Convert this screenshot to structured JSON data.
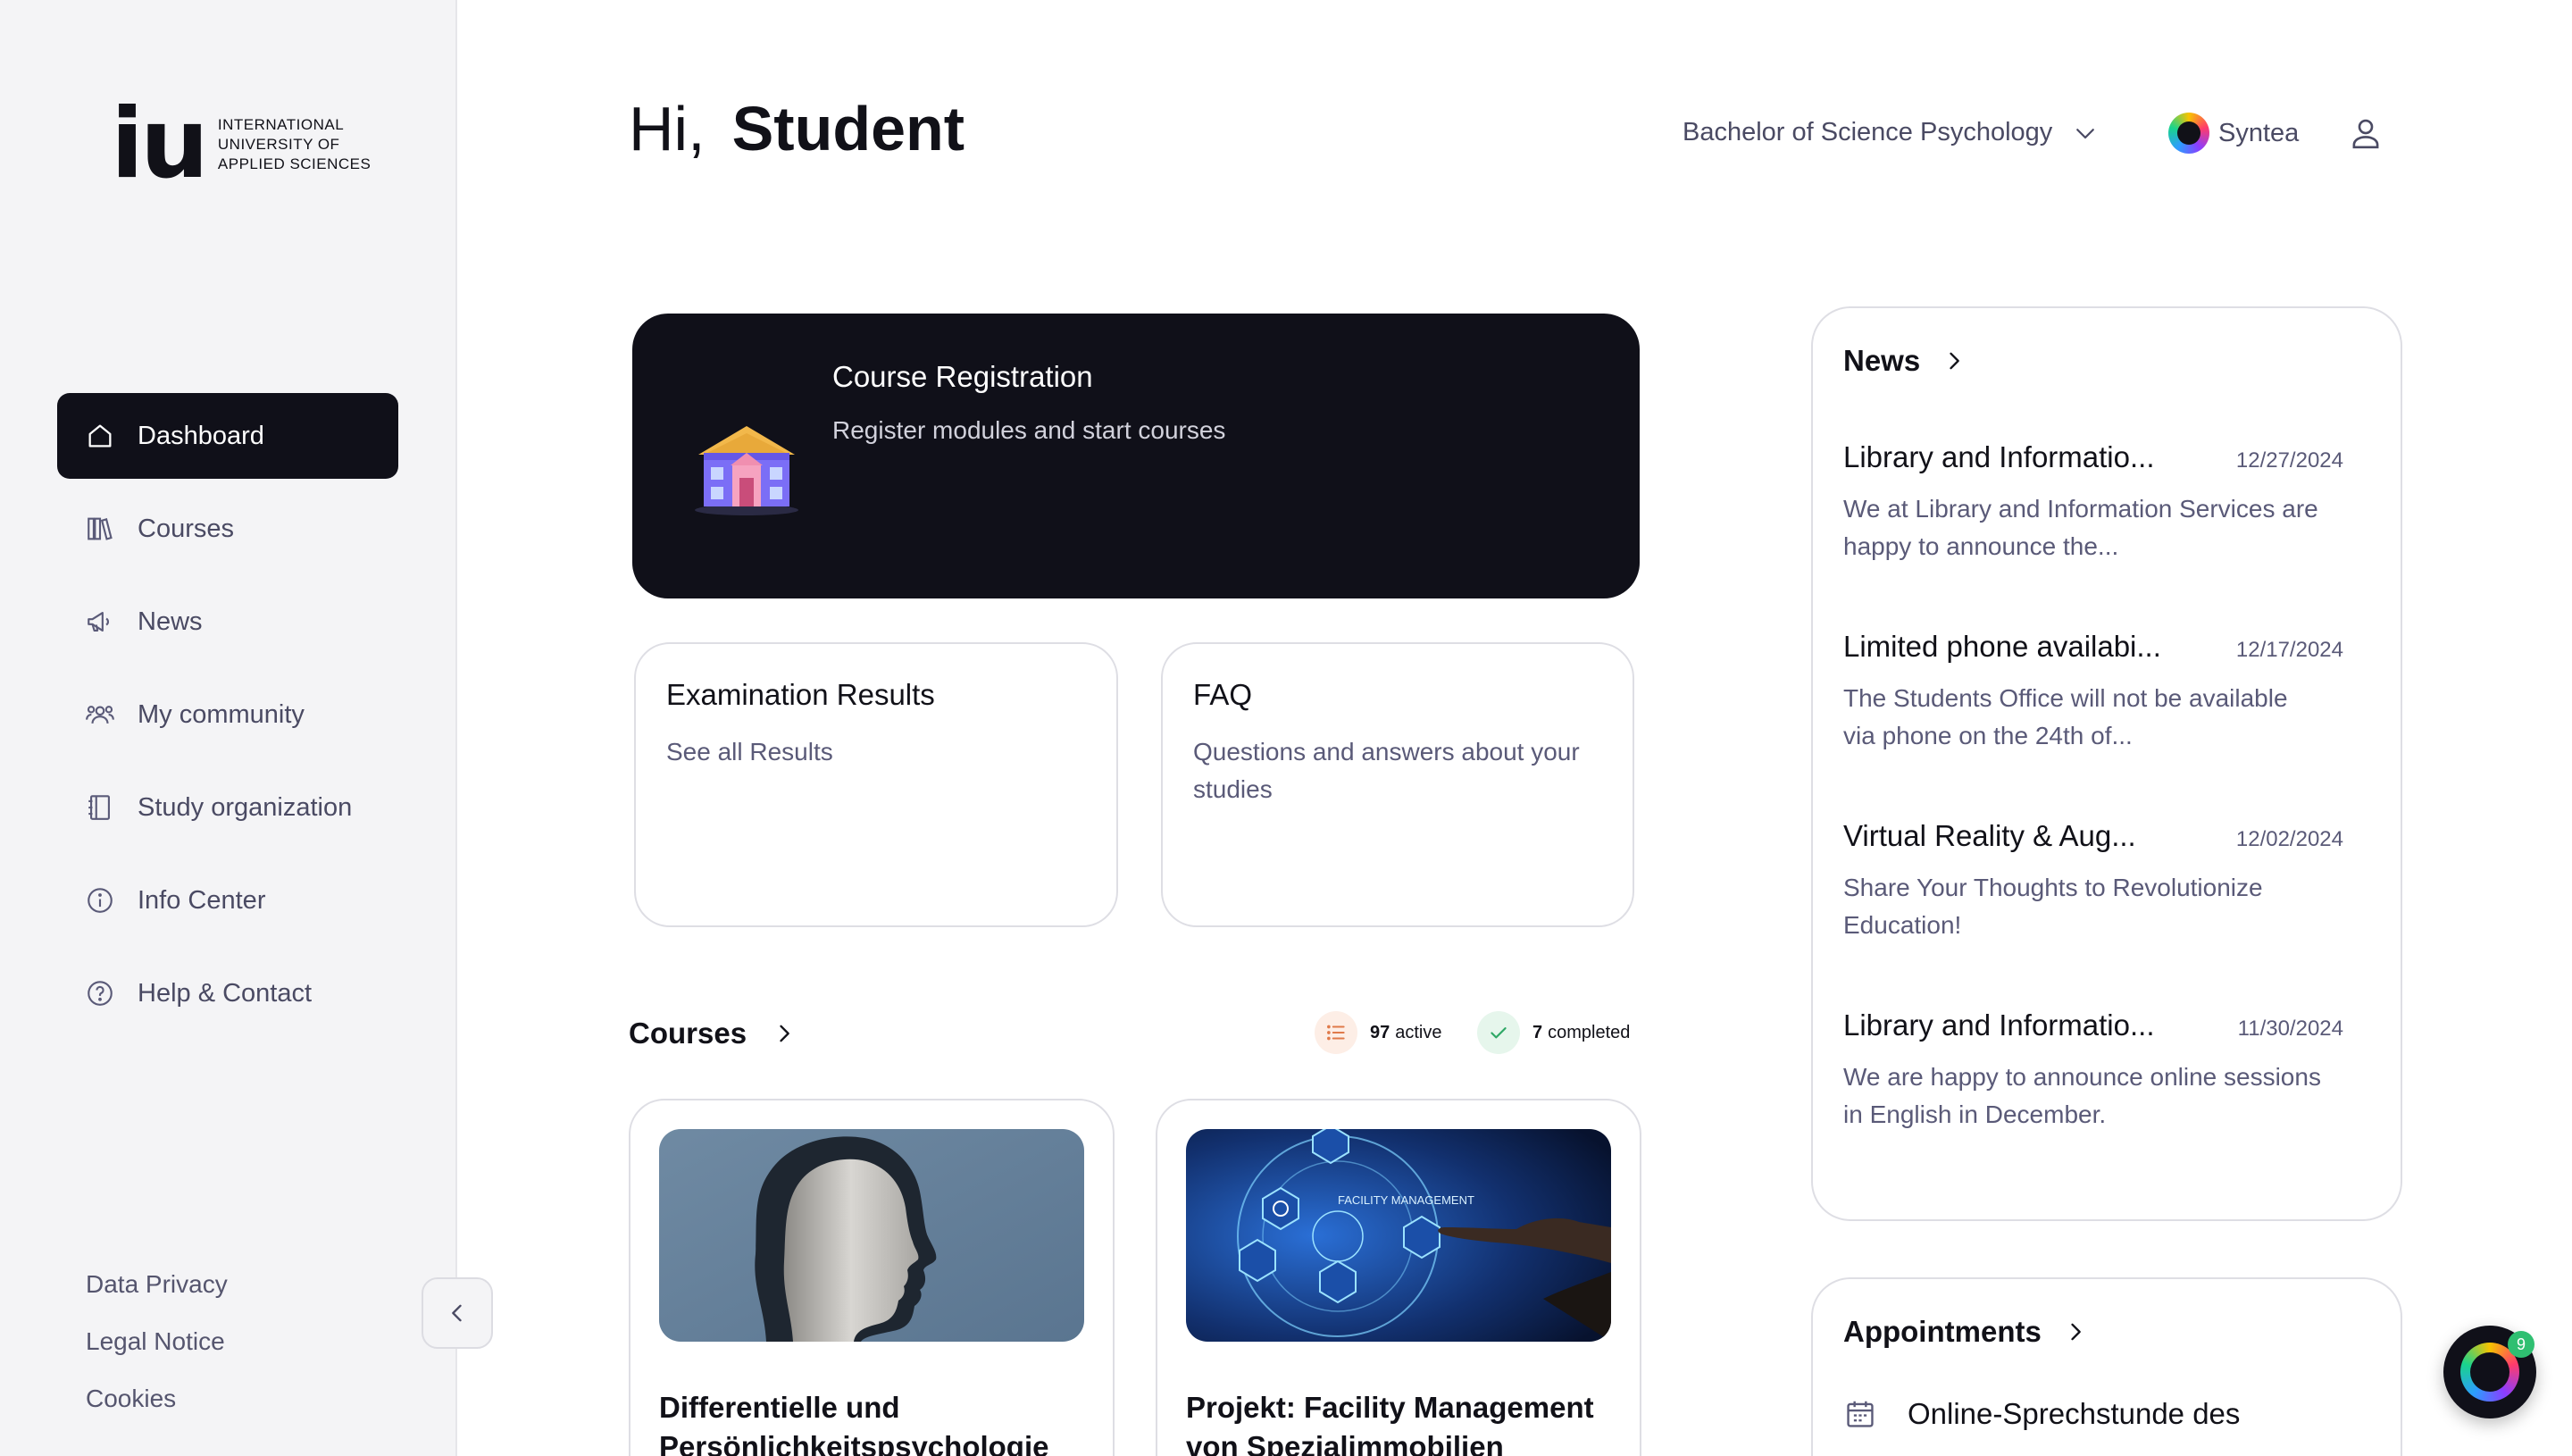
{
  "logo": {
    "mark": "iu",
    "line1": "INTERNATIONAL",
    "line2": "UNIVERSITY OF",
    "line3": "APPLIED SCIENCES"
  },
  "sidebar": {
    "items": [
      {
        "label": "Dashboard",
        "icon": "home-icon",
        "active": true
      },
      {
        "label": "Courses",
        "icon": "books-icon"
      },
      {
        "label": "News",
        "icon": "megaphone-icon"
      },
      {
        "label": "My community",
        "icon": "community-icon"
      },
      {
        "label": "Study organization",
        "icon": "notebook-icon"
      },
      {
        "label": "Info Center",
        "icon": "info-icon"
      },
      {
        "label": "Help & Contact",
        "icon": "help-icon"
      }
    ],
    "footer": [
      "Data Privacy",
      "Legal Notice",
      "Cookies"
    ],
    "collapse_icon": "chevron-left-icon"
  },
  "header": {
    "greeting": "Hi,",
    "name": "Student",
    "program": "Bachelor of Science Psychology",
    "assistant": "Syntea"
  },
  "registration": {
    "title": "Course Registration",
    "subtitle": "Register modules and start courses",
    "icon": "school-building-icon"
  },
  "exam": {
    "title": "Examination Results",
    "subtitle": "See all Results"
  },
  "faq": {
    "title": "FAQ",
    "subtitle": "Questions and answers about your studies"
  },
  "courses": {
    "title": "Courses",
    "active_count": "97",
    "active_label": "active",
    "completed_count": "7",
    "completed_label": "completed",
    "cards": [
      {
        "title": "Differentielle und Persönlichkeitspsychologie",
        "image": "head-silhouette-image"
      },
      {
        "title": "Projekt: Facility Management von Spezialimmobilien",
        "image": "facility-management-image",
        "image_caption": "FACILITY MANAGEMENT"
      }
    ]
  },
  "news": {
    "title": "News",
    "items": [
      {
        "title": "Library and Informatio...",
        "date": "12/27/2024",
        "summary": "We at Library and Information Services are happy to announce the..."
      },
      {
        "title": "Limited phone availabi...",
        "date": "12/17/2024",
        "summary": "The Students Office will not be available via phone on the 24th of..."
      },
      {
        "title": "Virtual Reality & Aug...",
        "date": "12/02/2024",
        "summary": "Share Your Thoughts to Revolutionize Education!"
      },
      {
        "title": "Library and Informatio...",
        "date": "11/30/2024",
        "summary": "We  are happy to announce online sessions in English in December."
      }
    ]
  },
  "appointments": {
    "title": "Appointments",
    "first_item": "Online-Sprechstunde des"
  },
  "chat": {
    "badge": "9"
  },
  "colors": {
    "dark": "#101019",
    "sidebar_bg": "#f4f4f6",
    "muted_text": "#5a5a78",
    "active_badge": "#fdeee6",
    "completed_badge": "#e6f6ec"
  }
}
